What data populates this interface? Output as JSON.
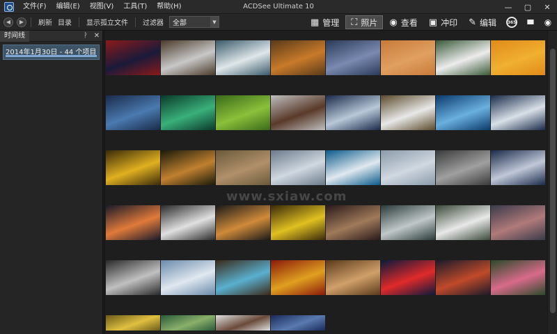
{
  "menu": [
    "文件(F)",
    "编辑(E)",
    "视图(V)",
    "工具(T)",
    "帮助(H)"
  ],
  "window_title": "ACDSee Ultimate 10",
  "window_buttons": [
    "—",
    "▢",
    "✕"
  ],
  "toolbar": {
    "refresh": "刷新",
    "catalog": "目录",
    "show_orphans": "显示孤立文件",
    "filter_label": "过滤器",
    "filter_value": "全部"
  },
  "modes": [
    {
      "label": "管理",
      "icon": "grid-icon",
      "glyph": "▦"
    },
    {
      "label": "照片",
      "icon": "photo-icon",
      "glyph": "⛶"
    },
    {
      "label": "查看",
      "icon": "eye-icon",
      "glyph": "◉"
    },
    {
      "label": "冲印",
      "icon": "develop-icon",
      "glyph": "▣"
    },
    {
      "label": "编辑",
      "icon": "edit-icon",
      "glyph": "✎"
    }
  ],
  "extra_tools": [
    "365",
    "▮▮▮",
    "◉"
  ],
  "panel": {
    "tab": "时间线",
    "pin": "ᚹ",
    "close": "✕",
    "timeline_entry": "2014年1月30日 - 44 个项目"
  },
  "watermark": "www.sxiaw.com",
  "thumbnails": [
    [
      "#8b1a1a",
      "#1a1a3a"
    ],
    [
      "#4a3a2a",
      "#c8c8c8"
    ],
    [
      "#3a5a6a",
      "#dfe7ea"
    ],
    [
      "#5a3a1a",
      "#c87a2a"
    ],
    [
      "#2a3a5a",
      "#7a8ab0"
    ],
    [
      "#c87a3a",
      "#e0a060"
    ],
    [
      "#3a5a3a",
      "#ececec"
    ],
    [
      "#e08a1a",
      "#f0b030"
    ],
    [
      "#1a2a4a",
      "#4a7ab0"
    ],
    [
      "#0a3a2a",
      "#3ab07a"
    ],
    [
      "#3a6a1a",
      "#8ac03a"
    ],
    [
      "#bfbfbf",
      "#5a3a2a"
    ],
    [
      "#1a2a4a",
      "#b8c8d8"
    ],
    [
      "#5a4a2a",
      "#e8e8e8"
    ],
    [
      "#0a3a6a",
      "#6ab0e0"
    ],
    [
      "#1a2a4a",
      "#d8e0e8"
    ],
    [
      "#3a2a0a",
      "#e0b020"
    ],
    [
      "#1a1a0a",
      "#c08030"
    ],
    [
      "#6a5a3a",
      "#b0906a"
    ],
    [
      "#6a7a8a",
      "#d0d8e0"
    ],
    [
      "#0a5a8a",
      "#e0e8f0"
    ],
    [
      "#8a9aaa",
      "#d0d8e0"
    ],
    [
      "#3a3a3a",
      "#a0a0a0"
    ],
    [
      "#1a2a4a",
      "#c0c8d8"
    ],
    [
      "#1a1a2a",
      "#e07a3a"
    ],
    [
      "#2a2a2a",
      "#e0e0e0"
    ],
    [
      "#1a1a1a",
      "#d08a3a"
    ],
    [
      "#3a2a0a",
      "#e0c020"
    ],
    [
      "#2a1a1a",
      "#a07a5a"
    ],
    [
      "#2a3a3a",
      "#c0c8c8"
    ],
    [
      "#3a4a3a",
      "#e8e8e8"
    ],
    [
      "#3a3a4a",
      "#b07a7a"
    ],
    [
      "#2a2a2a",
      "#c0c0c0"
    ],
    [
      "#6a8aaa",
      "#e0e8f0"
    ],
    [
      "#3a2a1a",
      "#5ab0d0"
    ],
    [
      "#8a1a0a",
      "#e0a020"
    ],
    [
      "#5a3a1a",
      "#d0a06a"
    ],
    [
      "#0a1a3a",
      "#e02a2a"
    ],
    [
      "#1a1a2a",
      "#c04a2a"
    ],
    [
      "#2a4a2a",
      "#d86a8a"
    ],
    [
      "#6a5a1a",
      "#e0c040"
    ],
    [
      "#2a5a3a",
      "#8ab06a"
    ],
    [
      "#e0e0e0",
      "#6a4a3a"
    ],
    [
      "#1a2a5a",
      "#5a7ab0"
    ]
  ]
}
